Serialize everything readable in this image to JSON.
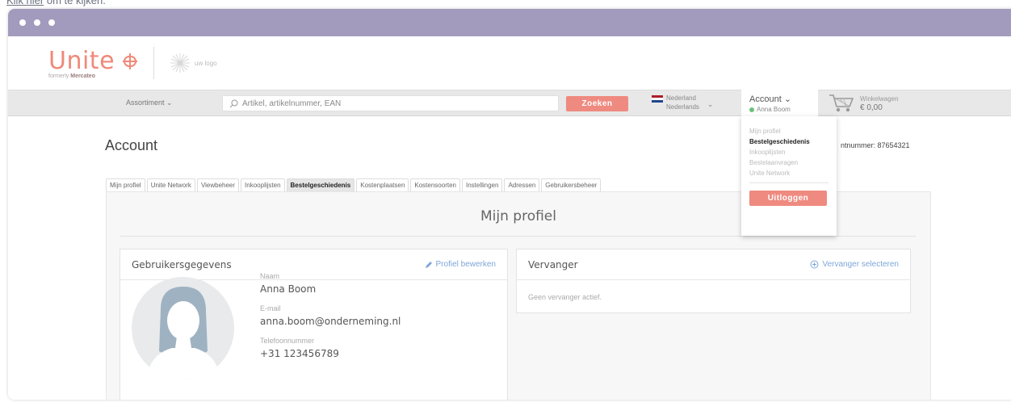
{
  "caption": {
    "link_text": "Klik hier",
    "rest_text": " om te kijken."
  },
  "brand": {
    "name": "Unite",
    "formerly_label": "formerly",
    "formerly_name": "Mercateo",
    "partner_logo_text": "uw logo"
  },
  "navbar": {
    "assortment_label": "Assortiment",
    "search_placeholder": "Artikel, artikelnummer, EAN",
    "search_button": "Zoeken",
    "country": "Nederland",
    "language": "Nederlands",
    "account_label": "Account",
    "account_user": "Anna Boom",
    "cart_label": "Winkelwagen",
    "cart_total": "€ 0,00"
  },
  "page": {
    "title": "Account",
    "customer_number": "ntnummer: 87654321",
    "tabs": [
      {
        "label": "Mijn profiel"
      },
      {
        "label": "Unite Network"
      },
      {
        "label": "Viewbeheer"
      },
      {
        "label": "Inkooplijsten"
      },
      {
        "label": "Bestelgeschiedenis"
      },
      {
        "label": "Kostenplaatsen"
      },
      {
        "label": "Kostensoorten"
      },
      {
        "label": "Instellingen"
      },
      {
        "label": "Adressen"
      },
      {
        "label": "Gebruikersbeheer"
      }
    ],
    "active_tab": "Bestelgeschiedenis",
    "section_title": "Mijn profiel"
  },
  "user_card": {
    "title": "Gebruikersgegevens",
    "action": "Profiel bewerken",
    "fields": [
      {
        "label": "Naam",
        "value": "Anna Boom"
      },
      {
        "label": "E-mail",
        "value": "anna.boom@onderneming.nl"
      },
      {
        "label": "Telefoonnummer",
        "value": "+31 123456789"
      }
    ]
  },
  "substitute_card": {
    "title": "Vervanger",
    "action": "Vervanger selecteren",
    "empty_text": "Geen vervanger actief."
  },
  "account_menu": {
    "items": [
      {
        "label": "Mijn profiel"
      },
      {
        "label": "Bestelgeschiedenis"
      },
      {
        "label": "Inkooplijsten"
      },
      {
        "label": "Bestelaanvragen"
      },
      {
        "label": "Unite Network"
      }
    ],
    "active_item": "Bestelgeschiedenis",
    "logout_label": "Uitloggen"
  },
  "colors": {
    "accent": "#ef8a80",
    "brand": "#f08979",
    "titlebar": "#a39bbd",
    "link": "#7fa6d8",
    "online": "#6cc17a"
  },
  "icons": {
    "search": "search-icon",
    "edit": "pencil-icon",
    "add": "plus-circle-icon",
    "cart": "cart-icon",
    "avatar": "user-avatar-icon"
  }
}
